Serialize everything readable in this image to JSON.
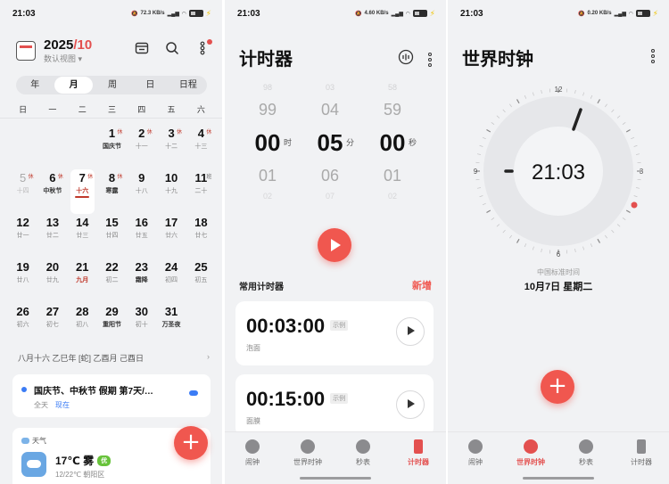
{
  "colors": {
    "accent": "#f0574f",
    "holiday_red": "#c0392b",
    "event_blue": "#3b7cf5",
    "aqi_green": "#67c23a"
  },
  "status_bar": [
    {
      "time": "21:03",
      "speed": "72.3 KB/s"
    },
    {
      "time": "21:03",
      "speed": "4.60 KB/s"
    },
    {
      "time": "21:03",
      "speed": "0.20 KB/s"
    }
  ],
  "calendar": {
    "year": "2025",
    "month": "/10",
    "subtitle": "数认视图",
    "icons": [
      "calendar-view-icon",
      "search-icon",
      "more-icon"
    ],
    "view_tabs": [
      "年",
      "月",
      "周",
      "日",
      "日程"
    ],
    "active_view": "月",
    "weekdays": [
      "日",
      "一",
      "二",
      "三",
      "四",
      "五",
      "六"
    ],
    "weeks": [
      [
        {
          "n": "",
          "l": ""
        },
        {
          "n": "",
          "l": ""
        },
        {
          "n": "",
          "l": ""
        },
        {
          "n": "1",
          "l": "国庆节",
          "cls": "fest",
          "tag": "休"
        },
        {
          "n": "2",
          "l": "十一",
          "tag": "休"
        },
        {
          "n": "3",
          "l": "十二",
          "tag": "休"
        },
        {
          "n": "4",
          "l": "十三",
          "tag": "休"
        }
      ],
      [
        {
          "n": "5",
          "l": "十四",
          "cls": "muted",
          "tag": "休"
        },
        {
          "n": "6",
          "l": "中秋节",
          "cls": "fest",
          "tag": "休"
        },
        {
          "n": "7",
          "l": "十六",
          "cls": "today",
          "tag": "休"
        },
        {
          "n": "8",
          "l": "寒露",
          "cls": "fest",
          "tag": "休"
        },
        {
          "n": "9",
          "l": "十八"
        },
        {
          "n": "10",
          "l": "十九"
        },
        {
          "n": "11",
          "l": "二十",
          "tag": "班"
        }
      ],
      [
        {
          "n": "12",
          "l": "廿一"
        },
        {
          "n": "13",
          "l": "廿二"
        },
        {
          "n": "14",
          "l": "廿三"
        },
        {
          "n": "15",
          "l": "廿四"
        },
        {
          "n": "16",
          "l": "廿五"
        },
        {
          "n": "17",
          "l": "廿六"
        },
        {
          "n": "18",
          "l": "廿七"
        }
      ],
      [
        {
          "n": "19",
          "l": "廿八"
        },
        {
          "n": "20",
          "l": "廿九"
        },
        {
          "n": "21",
          "l": "九月",
          "cls": "hl"
        },
        {
          "n": "22",
          "l": "初二"
        },
        {
          "n": "23",
          "l": "霜降",
          "cls": "fest"
        },
        {
          "n": "24",
          "l": "初四"
        },
        {
          "n": "25",
          "l": "初五"
        }
      ],
      [
        {
          "n": "26",
          "l": "初六"
        },
        {
          "n": "27",
          "l": "初七"
        },
        {
          "n": "28",
          "l": "初八"
        },
        {
          "n": "29",
          "l": "重阳节",
          "cls": "fest"
        },
        {
          "n": "30",
          "l": "初十"
        },
        {
          "n": "31",
          "l": "万圣夜",
          "cls": "fest"
        },
        {
          "n": "",
          "l": ""
        }
      ]
    ],
    "lunar_line": "八月十六 乙巳年 [蛇] 乙酉月 己酉日",
    "event": {
      "title": "国庆节、中秋节 假期 第7天/…",
      "allday": "全天",
      "now": "现在"
    },
    "weather": {
      "label": "天气",
      "temp": "17℃ 雾",
      "aqi": "优",
      "range": "12/22℃  朝阳区"
    },
    "add_label": "+"
  },
  "timer": {
    "title": "计时器",
    "picker": {
      "hours": {
        "far_up": "98",
        "up": "99",
        "main": "00",
        "unit": "时",
        "down": "01",
        "far_down": "02"
      },
      "minutes": {
        "far_up": "03",
        "up": "04",
        "main": "05",
        "unit": "分",
        "down": "06",
        "far_down": "07"
      },
      "seconds": {
        "far_up": "58",
        "up": "59",
        "main": "00",
        "unit": "秒",
        "down": "01",
        "far_down": "02"
      }
    },
    "common_title": "常用计时器",
    "add_new": "新增",
    "presets": [
      {
        "time": "00:03:00",
        "tag": "示例",
        "name": "泡面"
      },
      {
        "time": "00:15:00",
        "tag": "示例",
        "name": "面膜"
      }
    ]
  },
  "world_clock": {
    "title": "世界时钟",
    "time": "21:03",
    "dial_numbers": [
      "12",
      "3",
      "6",
      "9"
    ],
    "city": "中国标准时间",
    "date": "10月7日  星期二",
    "add_label": "+"
  },
  "tabbar": {
    "items": [
      {
        "label": "闹钟",
        "icon": "alarm-icon"
      },
      {
        "label": "世界时钟",
        "icon": "globe-icon"
      },
      {
        "label": "秒表",
        "icon": "stopwatch-icon"
      },
      {
        "label": "计时器",
        "icon": "hourglass-icon"
      }
    ],
    "active_panel2": "计时器",
    "active_panel3": "世界时钟"
  }
}
